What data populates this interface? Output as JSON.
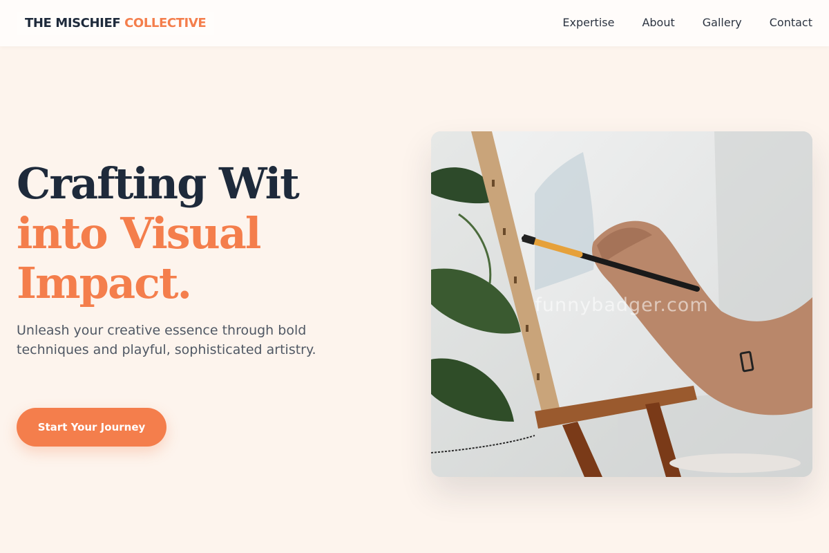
{
  "nav": {
    "logo_main": "THE MISCHIEF ",
    "logo_accent": "COLLECTIVE",
    "links": [
      "Expertise",
      "About",
      "Gallery",
      "Contact"
    ]
  },
  "hero": {
    "headline_line1": "Crafting Wit",
    "headline_line2": "into Visual",
    "headline_line3": "Impact.",
    "subtext": "Unleash your creative essence through bold techniques and playful, sophisticated artistry.",
    "cta_label": "Start Your Journey",
    "image_watermark": "funnybadger.com"
  },
  "colors": {
    "accent": "#f47e4c",
    "dark": "#1e2a3b",
    "background": "#fdf4ed"
  }
}
